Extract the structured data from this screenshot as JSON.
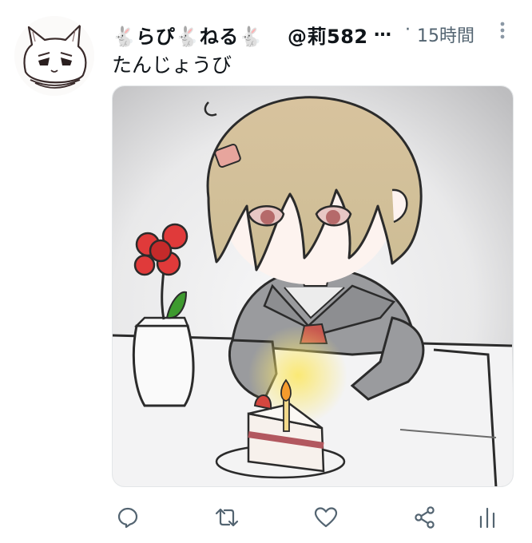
{
  "tweet": {
    "display_name": "🐇らぴ🐇ねる🐇",
    "handle": "@莉582",
    "handle_truncation": "…",
    "separator": "·",
    "time_ago": "15時間",
    "text": "たんじょうび"
  },
  "icons": {
    "avatar": "white-cat-sketch-avatar",
    "more": "vertical-ellipsis-icon",
    "reply": "speech-bubble-icon",
    "retweet": "retweet-arrows-icon",
    "like": "heart-icon",
    "share": "share-nodes-icon",
    "analytics": "bar-chart-icon"
  },
  "media": {
    "description_colors": {
      "hair": "#d9c9a6",
      "flower": "#e03a3a",
      "leaf": "#3e9a2f",
      "uniform": "#9a9b9e",
      "candle_glow": "#f6dc63"
    }
  },
  "colors": {
    "text_primary": "#0f1419",
    "text_secondary": "#536471",
    "icon_gray": "#536471"
  }
}
